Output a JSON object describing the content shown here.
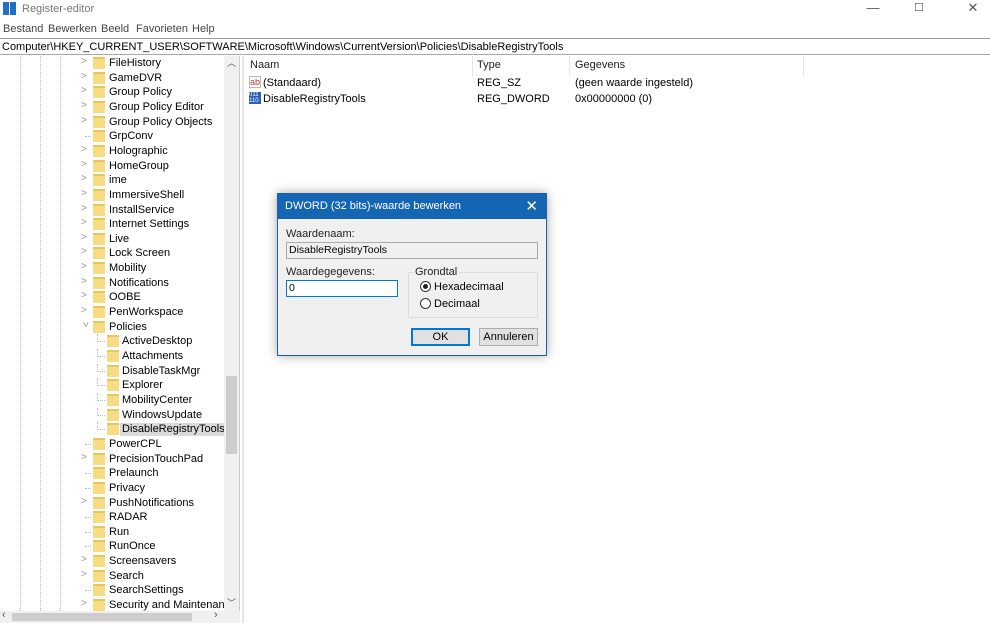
{
  "window": {
    "title": "Register-editor",
    "minimize": "—",
    "maximize": "☐",
    "close": "✕"
  },
  "menu": [
    "Bestand",
    "Bewerken",
    "Beeld",
    "Favorieten",
    "Help"
  ],
  "address": "Computer\\HKEY_CURRENT_USER\\SOFTWARE\\Microsoft\\Windows\\CurrentVersion\\Policies\\DisableRegistryTools",
  "tree": [
    {
      "label": "FileHistory",
      "expander": "collapsed"
    },
    {
      "label": "GameDVR",
      "expander": "collapsed"
    },
    {
      "label": "Group Policy",
      "expander": "collapsed"
    },
    {
      "label": "Group Policy Editor",
      "expander": "collapsed"
    },
    {
      "label": "Group Policy Objects",
      "expander": "collapsed"
    },
    {
      "label": "GrpConv",
      "expander": "none"
    },
    {
      "label": "Holographic",
      "expander": "collapsed"
    },
    {
      "label": "HomeGroup",
      "expander": "collapsed"
    },
    {
      "label": "ime",
      "expander": "collapsed"
    },
    {
      "label": "ImmersiveShell",
      "expander": "collapsed"
    },
    {
      "label": "InstallService",
      "expander": "collapsed"
    },
    {
      "label": "Internet Settings",
      "expander": "collapsed"
    },
    {
      "label": "Live",
      "expander": "collapsed"
    },
    {
      "label": "Lock Screen",
      "expander": "collapsed"
    },
    {
      "label": "Mobility",
      "expander": "collapsed"
    },
    {
      "label": "Notifications",
      "expander": "collapsed"
    },
    {
      "label": "OOBE",
      "expander": "collapsed"
    },
    {
      "label": "PenWorkspace",
      "expander": "collapsed"
    },
    {
      "label": "Policies",
      "expander": "expanded"
    },
    {
      "label": "ActiveDesktop",
      "child": true
    },
    {
      "label": "Attachments",
      "child": true
    },
    {
      "label": "DisableTaskMgr",
      "child": true
    },
    {
      "label": "Explorer",
      "child": true
    },
    {
      "label": "MobilityCenter",
      "child": true
    },
    {
      "label": "WindowsUpdate",
      "child": true
    },
    {
      "label": "DisableRegistryTools",
      "child": true,
      "selected": true
    },
    {
      "label": "PowerCPL",
      "expander": "none"
    },
    {
      "label": "PrecisionTouchPad",
      "expander": "collapsed"
    },
    {
      "label": "Prelaunch",
      "expander": "none"
    },
    {
      "label": "Privacy",
      "expander": "none"
    },
    {
      "label": "PushNotifications",
      "expander": "collapsed"
    },
    {
      "label": "RADAR",
      "expander": "none"
    },
    {
      "label": "Run",
      "expander": "none"
    },
    {
      "label": "RunOnce",
      "expander": "none"
    },
    {
      "label": "Screensavers",
      "expander": "collapsed"
    },
    {
      "label": "Search",
      "expander": "collapsed"
    },
    {
      "label": "SearchSettings",
      "expander": "none"
    },
    {
      "label": "Security and Maintenance",
      "expander": "collapsed"
    }
  ],
  "list": {
    "headers": [
      "Naam",
      "Type",
      "Gegevens"
    ],
    "rows": [
      {
        "icon": "string-value-icon",
        "name": "(Standaard)",
        "type": "REG_SZ",
        "data": "(geen waarde ingesteld)"
      },
      {
        "icon": "binary-value-icon",
        "name": "DisableRegistryTools",
        "type": "REG_DWORD",
        "data": "0x00000000 (0)"
      }
    ]
  },
  "dialog": {
    "title": "DWORD (32 bits)-waarde bewerken",
    "name_label": "Waardenaam:",
    "name_value": "DisableRegistryTools",
    "data_label": "Waardegegevens:",
    "data_value": "0",
    "base_label": "Grondtal",
    "hex": "Hexadecimaal",
    "dec": "Decimaal",
    "selected_base": "Hexadecimaal",
    "ok": "OK",
    "cancel": "Annuleren",
    "accent": "#1565b5"
  }
}
